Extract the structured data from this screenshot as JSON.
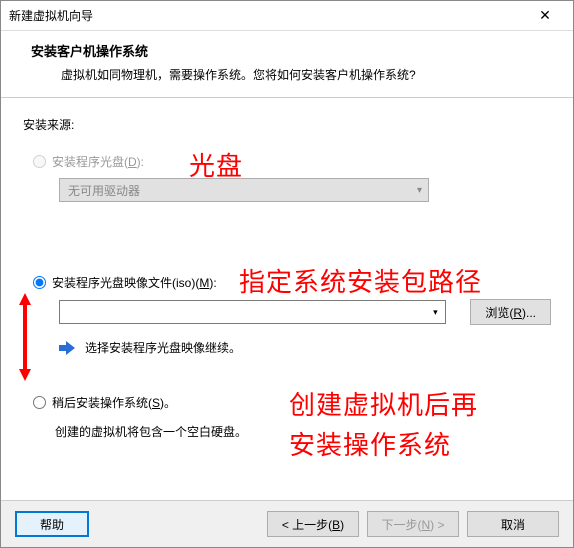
{
  "window": {
    "title": "新建虚拟机向导"
  },
  "header": {
    "title": "安装客户机操作系统",
    "subtitle": "虚拟机如同物理机，需要操作系统。您将如何安装客户机操作系统?"
  },
  "content": {
    "source_label": "安装来源:",
    "opt_disc": {
      "prefix": "安装程序光盘(",
      "hotkey": "D",
      "suffix": "):"
    },
    "disc_dropdown": "无可用驱动器",
    "opt_iso": {
      "prefix": "安装程序光盘映像文件(iso)(",
      "hotkey": "M",
      "suffix": "):"
    },
    "iso_value": "",
    "browse": {
      "prefix": "浏览(",
      "hotkey": "R",
      "suffix": ")..."
    },
    "hint": "选择安装程序光盘映像继续。",
    "opt_later": {
      "prefix": "稍后安装操作系统(",
      "hotkey": "S",
      "suffix": ")。"
    },
    "note": "创建的虚拟机将包含一个空白硬盘。"
  },
  "footer": {
    "help": "帮助",
    "back": {
      "prefix": "< 上一步(",
      "hotkey": "B",
      "suffix": ")"
    },
    "next": {
      "prefix": "下一步(",
      "hotkey": "N",
      "suffix": ") >"
    },
    "cancel": "取消"
  },
  "annotations": {
    "a1": "光盘",
    "a2": "指定系统安装包路径",
    "a3_line1": "创建虚拟机后再",
    "a3_line2": "安装操作系统"
  }
}
